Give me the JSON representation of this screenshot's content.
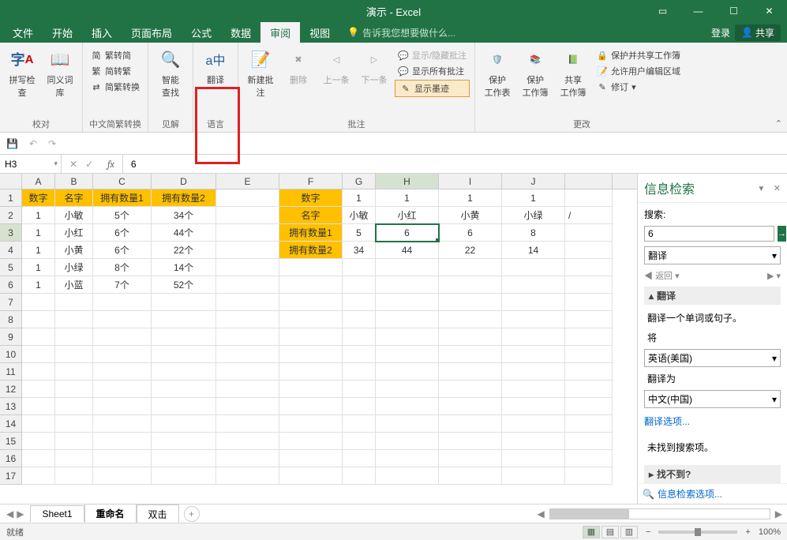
{
  "titlebar": {
    "title": "演示 - Excel"
  },
  "menubar": {
    "items": [
      "文件",
      "开始",
      "插入",
      "页面布局",
      "公式",
      "数据",
      "审阅",
      "视图"
    ],
    "active": 6,
    "tellme": "告诉我您想要做什么...",
    "login": "登录",
    "share": "共享"
  },
  "ribbon": {
    "groups": {
      "proofing": {
        "label": "校对",
        "spelling": "拼写检查",
        "thesaurus": "同义词库"
      },
      "chinese": {
        "label": "中文简繁转换",
        "simp": "繁转简",
        "trad": "简转繁",
        "conv": "简繁转换"
      },
      "insights": {
        "label": "见解",
        "smart": "智能\n查找"
      },
      "language": {
        "label": "语言",
        "translate": "翻译"
      },
      "comments": {
        "label": "批注",
        "new": "新建批注",
        "delete": "删除",
        "prev": "上一条",
        "next": "下一条",
        "showhide": "显示/隐藏批注",
        "showall": "显示所有批注",
        "ink": "显示墨迹"
      },
      "changes": {
        "label": "更改",
        "protect_sheet": "保护\n工作表",
        "protect_wb": "保护\n工作簿",
        "share_wb": "共享\n工作簿",
        "protect_share": "保护并共享工作簿",
        "allow_edit": "允许用户编辑区域",
        "track": "修订"
      }
    }
  },
  "formula_bar": {
    "namebox": "H3",
    "value": "6"
  },
  "columns": [
    "A",
    "B",
    "C",
    "D",
    "E",
    "F",
    "G",
    "H",
    "I",
    "J"
  ],
  "rows_count": 26,
  "data": {
    "r1": {
      "A": "数字",
      "B": "名字",
      "C": "拥有数量1",
      "D": "拥有数量2",
      "F": "数字",
      "G": "1",
      "H": "1",
      "I": "1",
      "J": "1"
    },
    "r2": {
      "A": "1",
      "B": "小敏",
      "C": "5个",
      "D": "34个",
      "F": "名字",
      "G": "小敏",
      "H": "小红",
      "I": "小黄",
      "J": "小绿"
    },
    "r3": {
      "A": "1",
      "B": "小红",
      "C": "6个",
      "D": "44个",
      "F": "拥有数量1",
      "G": "5",
      "H": "6",
      "I": "6",
      "J": "8"
    },
    "r4": {
      "A": "1",
      "B": "小黄",
      "C": "6个",
      "D": "22个",
      "F": "拥有数量2",
      "G": "34",
      "H": "44",
      "I": "22",
      "J": "14"
    },
    "r5": {
      "A": "1",
      "B": "小绿",
      "C": "8个",
      "D": "14个"
    },
    "r6": {
      "A": "1",
      "B": "小蓝",
      "C": "7个",
      "D": "52个"
    }
  },
  "orange_cells": [
    "r1A",
    "r1B",
    "r1C",
    "r1D",
    "r1F",
    "r2F",
    "r3F",
    "r4F"
  ],
  "selected_cell": "r3H",
  "research": {
    "title": "信息检索",
    "search_label": "搜索:",
    "search_value": "6",
    "service": "翻译",
    "back": "返回",
    "section": "翻译",
    "desc": "翻译一个单词或句子。",
    "from_label": "将",
    "from_value": "英语(美国)",
    "to_label": "翻译为",
    "to_value": "中文(中国)",
    "options": "翻译选项...",
    "noresult": "未找到搜索项。",
    "notfound": "找不到?",
    "opts_link": "信息检索选项..."
  },
  "sheet_tabs": {
    "tabs": [
      "Sheet1",
      "重命名",
      "双击"
    ],
    "active": 1
  },
  "status": {
    "ready": "就绪",
    "zoom": "100%"
  }
}
